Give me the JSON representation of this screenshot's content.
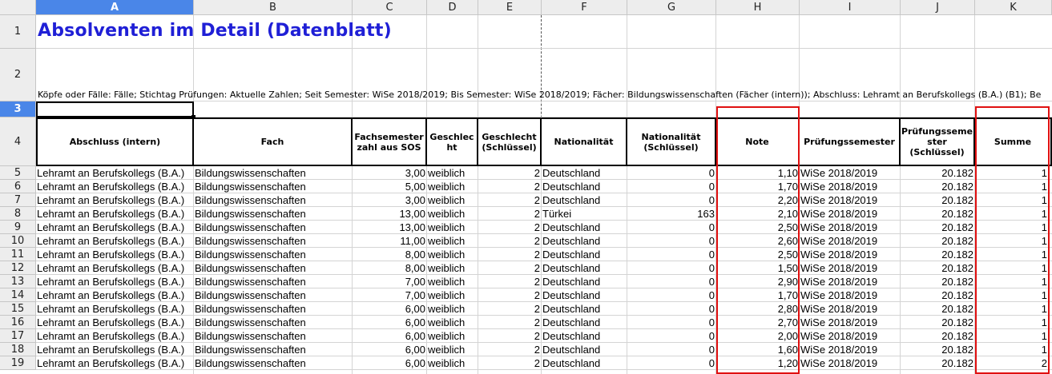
{
  "columns": [
    "A",
    "B",
    "C",
    "D",
    "E",
    "F",
    "G",
    "H",
    "I",
    "J",
    "K"
  ],
  "selected_column": "A",
  "selected_row": "3",
  "row_numbers": [
    "1",
    "2",
    "3",
    "4",
    "5",
    "6",
    "7",
    "8",
    "9",
    "10",
    "11",
    "12",
    "13",
    "14",
    "15",
    "16",
    "17",
    "18",
    "19"
  ],
  "title": "Absolventen im Detail (Datenblatt)",
  "filter_text": "Köpfe oder Fälle: Fälle; Stichtag Prüfungen: Aktuelle Zahlen; Seit Semester: WiSe 2018/2019; Bis Semester: WiSe 2018/2019; Fächer: Bildungswissenschaften (Fächer (intern)); Abschluss: Lehramt an Berufskollegs (B.A.) (B1);  Be",
  "headers": [
    "Abschluss (intern)",
    "Fach",
    "Fachsemester zahl aus SOS",
    "Geschlec ht",
    "Geschlecht (Schlüssel)",
    "Nationalität",
    "Nationalität (Schlüssel)",
    "Note",
    "Prüfungssemester",
    "Prüfungsseme ster (Schlüssel)",
    "Summe"
  ],
  "rows": [
    [
      "Lehramt an Berufskollegs (B.A.)",
      "Bildungswissenschaften",
      "3,00",
      "weiblich",
      "2",
      "Deutschland",
      "0",
      "1,10",
      "WiSe 2018/2019",
      "20.182",
      "1"
    ],
    [
      "Lehramt an Berufskollegs (B.A.)",
      "Bildungswissenschaften",
      "5,00",
      "weiblich",
      "2",
      "Deutschland",
      "0",
      "1,70",
      "WiSe 2018/2019",
      "20.182",
      "1"
    ],
    [
      "Lehramt an Berufskollegs (B.A.)",
      "Bildungswissenschaften",
      "3,00",
      "weiblich",
      "2",
      "Deutschland",
      "0",
      "2,20",
      "WiSe 2018/2019",
      "20.182",
      "1"
    ],
    [
      "Lehramt an Berufskollegs (B.A.)",
      "Bildungswissenschaften",
      "13,00",
      "weiblich",
      "2",
      "Türkei",
      "163",
      "2,10",
      "WiSe 2018/2019",
      "20.182",
      "1"
    ],
    [
      "Lehramt an Berufskollegs (B.A.)",
      "Bildungswissenschaften",
      "13,00",
      "weiblich",
      "2",
      "Deutschland",
      "0",
      "2,50",
      "WiSe 2018/2019",
      "20.182",
      "1"
    ],
    [
      "Lehramt an Berufskollegs (B.A.)",
      "Bildungswissenschaften",
      "11,00",
      "weiblich",
      "2",
      "Deutschland",
      "0",
      "2,60",
      "WiSe 2018/2019",
      "20.182",
      "1"
    ],
    [
      "Lehramt an Berufskollegs (B.A.)",
      "Bildungswissenschaften",
      "8,00",
      "weiblich",
      "2",
      "Deutschland",
      "0",
      "2,50",
      "WiSe 2018/2019",
      "20.182",
      "1"
    ],
    [
      "Lehramt an Berufskollegs (B.A.)",
      "Bildungswissenschaften",
      "8,00",
      "weiblich",
      "2",
      "Deutschland",
      "0",
      "1,50",
      "WiSe 2018/2019",
      "20.182",
      "1"
    ],
    [
      "Lehramt an Berufskollegs (B.A.)",
      "Bildungswissenschaften",
      "7,00",
      "weiblich",
      "2",
      "Deutschland",
      "0",
      "2,90",
      "WiSe 2018/2019",
      "20.182",
      "1"
    ],
    [
      "Lehramt an Berufskollegs (B.A.)",
      "Bildungswissenschaften",
      "7,00",
      "weiblich",
      "2",
      "Deutschland",
      "0",
      "1,70",
      "WiSe 2018/2019",
      "20.182",
      "1"
    ],
    [
      "Lehramt an Berufskollegs (B.A.)",
      "Bildungswissenschaften",
      "6,00",
      "weiblich",
      "2",
      "Deutschland",
      "0",
      "2,80",
      "WiSe 2018/2019",
      "20.182",
      "1"
    ],
    [
      "Lehramt an Berufskollegs (B.A.)",
      "Bildungswissenschaften",
      "6,00",
      "weiblich",
      "2",
      "Deutschland",
      "0",
      "2,70",
      "WiSe 2018/2019",
      "20.182",
      "1"
    ],
    [
      "Lehramt an Berufskollegs (B.A.)",
      "Bildungswissenschaften",
      "6,00",
      "weiblich",
      "2",
      "Deutschland",
      "0",
      "2,00",
      "WiSe 2018/2019",
      "20.182",
      "1"
    ],
    [
      "Lehramt an Berufskollegs (B.A.)",
      "Bildungswissenschaften",
      "6,00",
      "weiblich",
      "2",
      "Deutschland",
      "0",
      "1,60",
      "WiSe 2018/2019",
      "20.182",
      "1"
    ],
    [
      "Lehramt an Berufskollegs (B.A.)",
      "Bildungswissenschaften",
      "6,00",
      "weiblich",
      "2",
      "Deutschland",
      "0",
      "1,20",
      "WiSe 2018/2019",
      "20.182",
      "2"
    ]
  ],
  "highlight_color": "#e01010",
  "title_color": "#1f1fd6",
  "selection_color": "#4a86e8"
}
